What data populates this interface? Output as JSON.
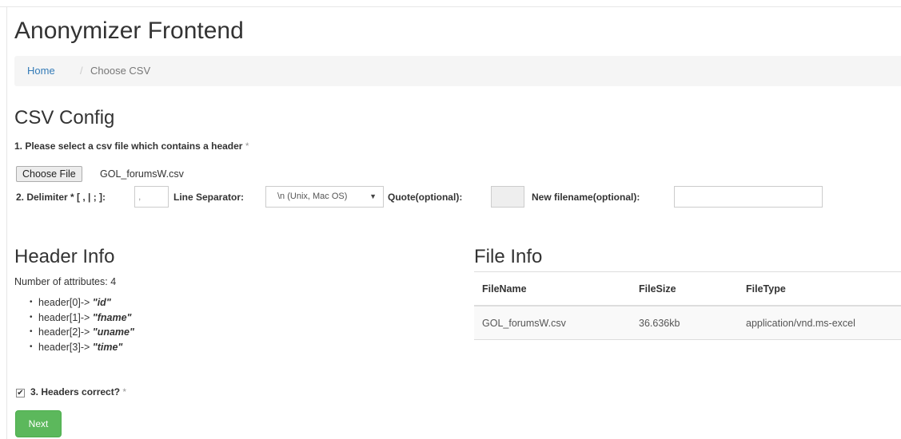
{
  "app": {
    "title": "Anonymizer Frontend"
  },
  "breadcrumb": {
    "home": "Home",
    "separator": "/",
    "current": "Choose CSV"
  },
  "csv_config": {
    "title": "CSV Config",
    "step1_label": "1. Please select a csv file which contains a header",
    "required_mark": "*",
    "choose_file_label": "Choose File",
    "file_name": "GOL_forumsW.csv",
    "delimiter_label": "2. Delimiter * [ , | ; ]:",
    "delimiter_value": ",",
    "line_separator_label": "Line Separator:",
    "line_separator_value": "\\n (Unix, Mac OS)",
    "quote_label": "Quote(optional):",
    "quote_value": "",
    "new_filename_label": "New filename(optional):",
    "new_filename_value": ""
  },
  "header_info": {
    "title": "Header Info",
    "attr_count_text": "Number of attributes: 4",
    "headers": [
      {
        "prefix": "header[0]->",
        "name": "\"id\""
      },
      {
        "prefix": "header[1]->",
        "name": "\"fname\""
      },
      {
        "prefix": "header[2]->",
        "name": "\"uname\""
      },
      {
        "prefix": "header[3]->",
        "name": "\"time\""
      }
    ],
    "step3_label": "3. Headers correct?",
    "step3_checked": true,
    "next_label": "Next"
  },
  "file_info": {
    "title": "File Info",
    "columns": [
      "FileName",
      "FileSize",
      "FileType"
    ],
    "rows": [
      [
        "GOL_forumsW.csv",
        "36.636kb",
        "application/vnd.ms-excel"
      ]
    ]
  },
  "colors": {
    "link": "#337ab7",
    "success": "#5cb85c",
    "breadcrumb_bg": "#f5f5f5"
  }
}
